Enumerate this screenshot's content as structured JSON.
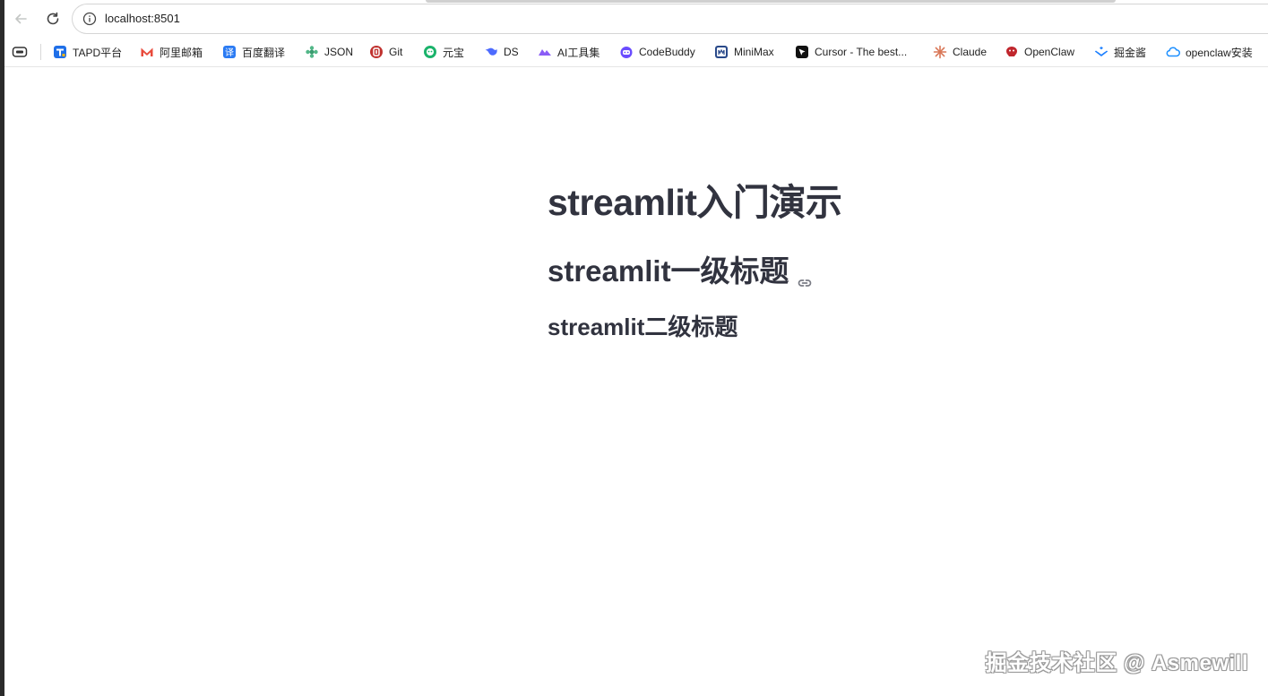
{
  "browser": {
    "url": "localhost:8501"
  },
  "bookmarks": [
    {
      "label": "TAPD平台",
      "icon": "tapd-icon",
      "color": "#1f6fe8"
    },
    {
      "label": "阿里邮箱",
      "icon": "aliyun-mail-icon",
      "color": "#e84a3b"
    },
    {
      "label": "百度翻译",
      "icon": "baidu-translate-icon",
      "color": "#2b7bf3"
    },
    {
      "label": "JSON",
      "icon": "json-icon",
      "color": "#52b788"
    },
    {
      "label": "Git",
      "icon": "git-icon",
      "color": "#c0322f"
    },
    {
      "label": "元宝",
      "icon": "yuanbao-icon",
      "color": "#1bb36b"
    },
    {
      "label": "DS",
      "icon": "deepseek-icon",
      "color": "#4d6bfe"
    },
    {
      "label": "AI工具集",
      "icon": "ai-tools-icon",
      "color": "#8a5cf6"
    },
    {
      "label": "CodeBuddy",
      "icon": "codebuddy-icon",
      "color": "#6a4cff"
    },
    {
      "label": "MiniMax",
      "icon": "minimax-icon",
      "color": "#2a4a8a"
    },
    {
      "label": "Cursor - The best...",
      "icon": "cursor-icon",
      "color": "#111111"
    },
    {
      "label": "Claude",
      "icon": "claude-icon",
      "color": "#d97757"
    },
    {
      "label": "OpenClaw",
      "icon": "openclaw-icon",
      "color": "#c0262d"
    },
    {
      "label": "掘金酱",
      "icon": "juejin-icon",
      "color": "#1e80ff"
    },
    {
      "label": "openclaw安装",
      "icon": "cloud-icon",
      "color": "#1e90ff"
    }
  ],
  "page": {
    "title": "streamlit入门演示",
    "header": "streamlit一级标题",
    "subheader": "streamlit二级标题"
  },
  "watermark": "掘金技术社区 @ Asmewill"
}
